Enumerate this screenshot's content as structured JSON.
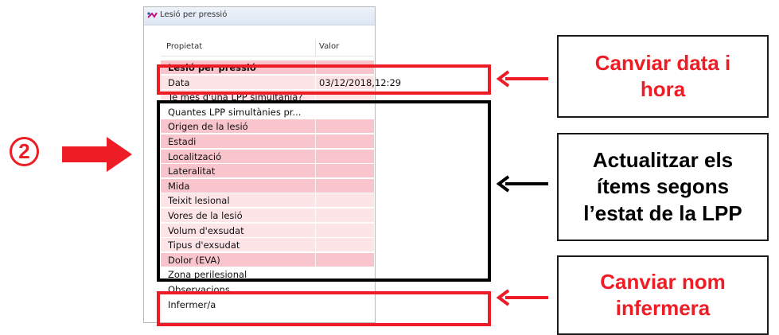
{
  "window": {
    "title": "Lesió per pressió"
  },
  "grid": {
    "headers": [
      "Propietat",
      "Valor"
    ],
    "rows": [
      {
        "name": "Lesió per pressió",
        "value": "",
        "style": "bg-dark group"
      },
      {
        "name": "Data",
        "value": "03/12/2018,12:29",
        "style": "bg-light"
      },
      {
        "name": "Té més d'una LPP simultània?",
        "value": "",
        "style": "bg-light"
      },
      {
        "name": "Quantes LPP simultànies pr...",
        "value": "",
        "style": "bg-white"
      },
      {
        "name": "Origen de la lesió",
        "value": "",
        "style": "bg-dark"
      },
      {
        "name": "Estadi",
        "value": "",
        "style": "bg-dark"
      },
      {
        "name": "Localització",
        "value": "",
        "style": "bg-dark"
      },
      {
        "name": "Lateralitat",
        "value": "",
        "style": "bg-dark"
      },
      {
        "name": "Mida",
        "value": "",
        "style": "bg-dark"
      },
      {
        "name": "Teixit lesional",
        "value": "",
        "style": "bg-light"
      },
      {
        "name": "Vores de la lesió",
        "value": "",
        "style": "bg-light"
      },
      {
        "name": "Volum d'exsudat",
        "value": "",
        "style": "bg-light"
      },
      {
        "name": "Tipus d'exsudat",
        "value": "",
        "style": "bg-light"
      },
      {
        "name": "Dolor (EVA)",
        "value": "",
        "style": "bg-dark"
      },
      {
        "name": "Zona perilesional",
        "value": "",
        "style": "bg-white"
      },
      {
        "name": "Observacions",
        "value": "",
        "style": "bg-white"
      },
      {
        "name": "Infermer/a",
        "value": "",
        "style": "bg-white"
      }
    ]
  },
  "annotations": {
    "step": "2",
    "callout_date": "Canviar data i\nhora",
    "callout_items": "Actualitzar els\nítems segons\nl’estat de la LPP",
    "callout_nurse": "Canviar nom\ninfermera"
  },
  "colors": {
    "annotation_red": "#ee1c25",
    "row_dark": "#f8c5cc",
    "row_light": "#fde4e7"
  }
}
